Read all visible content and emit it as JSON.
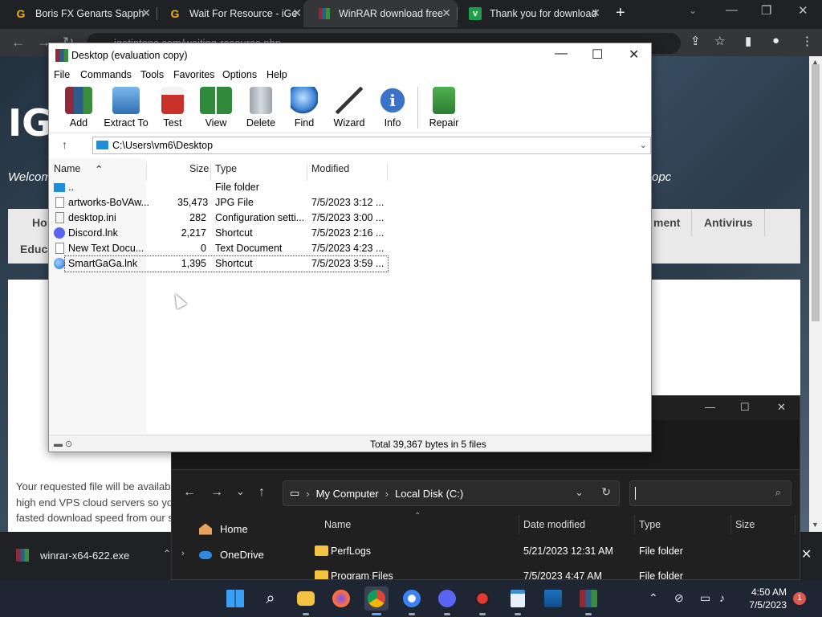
{
  "browser": {
    "tabs": [
      {
        "label": "Boris FX Genarts Sapph",
        "icon": "G"
      },
      {
        "label": "Wait For Resource - iGe",
        "icon": "G"
      },
      {
        "label": "WinRAR download free",
        "icon": ""
      },
      {
        "label": "Thank you for download",
        "icon": "v"
      }
    ],
    "address": "igetintopc.com/waiting-resource.php"
  },
  "webpage": {
    "logo": "IG",
    "welcome": "Welcom",
    "welcome_tail": "opc",
    "nav": [
      "Ho",
      "ment",
      "Antivirus",
      "Educa"
    ],
    "body_text": "Your requested file will be availab high end VPS cloud servers so yo fasted download speed from our s"
  },
  "download_bar": {
    "filename": "winrar-x64-622.exe"
  },
  "winrar": {
    "title": "Desktop (evaluation copy)",
    "menu": [
      "File",
      "Commands",
      "Tools",
      "Favorites",
      "Options",
      "Help"
    ],
    "toolbar": [
      "Add",
      "Extract To",
      "Test",
      "View",
      "Delete",
      "Find",
      "Wizard",
      "Info",
      "Repair"
    ],
    "path": "C:\\Users\\vm6\\Desktop",
    "columns": [
      "Name",
      "Size",
      "Type",
      "Modified"
    ],
    "rows": [
      {
        "name": "..",
        "size": "",
        "type": "File folder",
        "modified": ""
      },
      {
        "name": "artworks-BoVAw...",
        "size": "35,473",
        "type": "JPG File",
        "modified": "7/5/2023 3:12 ..."
      },
      {
        "name": "desktop.ini",
        "size": "282",
        "type": "Configuration setti...",
        "modified": "7/5/2023 3:00 ..."
      },
      {
        "name": "Discord.lnk",
        "size": "2,217",
        "type": "Shortcut",
        "modified": "7/5/2023 2:16 ..."
      },
      {
        "name": "New Text Docu...",
        "size": "0",
        "type": "Text Document",
        "modified": "7/5/2023 4:23 ..."
      },
      {
        "name": "SmartGaGa.lnk",
        "size": "1,395",
        "type": "Shortcut",
        "modified": "7/5/2023 3:59 ..."
      }
    ],
    "status": "Total 39,367 bytes in 5 files"
  },
  "explorer": {
    "breadcrumb": [
      "My Computer",
      "Local Disk (C:)"
    ],
    "sidebar": [
      "Home",
      "OneDrive"
    ],
    "columns": [
      "Name",
      "Date modified",
      "Type",
      "Size"
    ],
    "rows": [
      {
        "name": "PerfLogs",
        "date": "5/21/2023 12:31 AM",
        "type": "File folder"
      },
      {
        "name": "Program Files",
        "date": "7/5/2023 4:47 AM",
        "type": "File folder"
      }
    ]
  },
  "taskbar": {
    "time": "4:50 AM",
    "date": "7/5/2023",
    "notifications": "1"
  }
}
